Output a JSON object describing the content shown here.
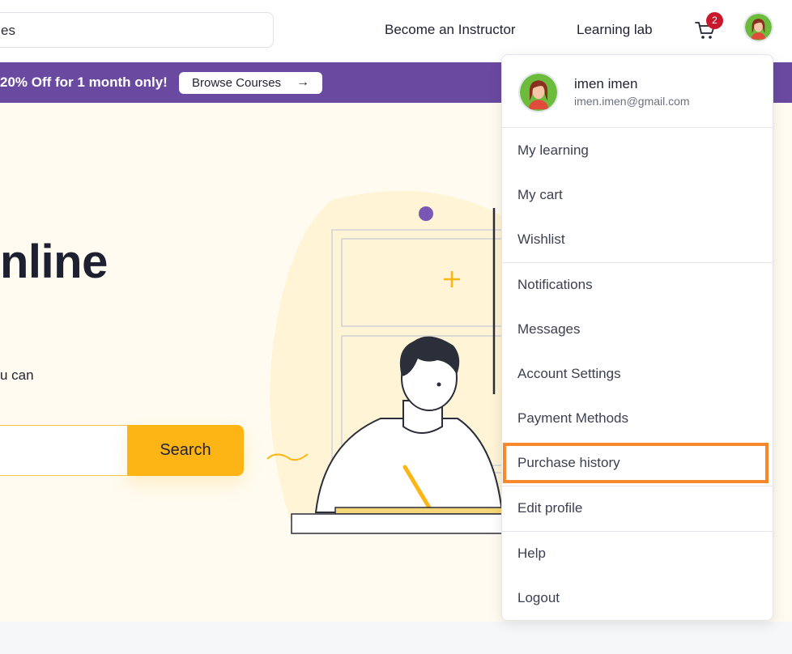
{
  "header": {
    "search_value": "es",
    "nav": [
      {
        "label": "Become an Instructor"
      },
      {
        "label": "Learning lab"
      }
    ],
    "cart_count": "2",
    "cart_icon": "cart-icon",
    "avatar_icon": "avatar-icon"
  },
  "promo": {
    "text": "20% Off for 1 month only!",
    "button_label": "Browse Courses",
    "button_icon": "arrow-right-icon",
    "color": "#6a4aa1"
  },
  "hero": {
    "title": "nline",
    "subtitle": "u can",
    "search_button": "Search",
    "accent": "#fdb515"
  },
  "dropdown": {
    "user_name": "imen imen",
    "user_email": "imen.imen@gmail.com",
    "groups": [
      [
        {
          "label": "My learning"
        },
        {
          "label": "My cart"
        },
        {
          "label": "Wishlist"
        }
      ],
      [
        {
          "label": "Notifications"
        },
        {
          "label": "Messages"
        },
        {
          "label": "Account Settings"
        },
        {
          "label": "Payment Methods"
        },
        {
          "label": "Purchase history"
        }
      ],
      [
        {
          "label": "Edit profile"
        }
      ],
      [
        {
          "label": "Help"
        },
        {
          "label": "Logout"
        }
      ]
    ],
    "highlight_color": "#f7892c"
  }
}
